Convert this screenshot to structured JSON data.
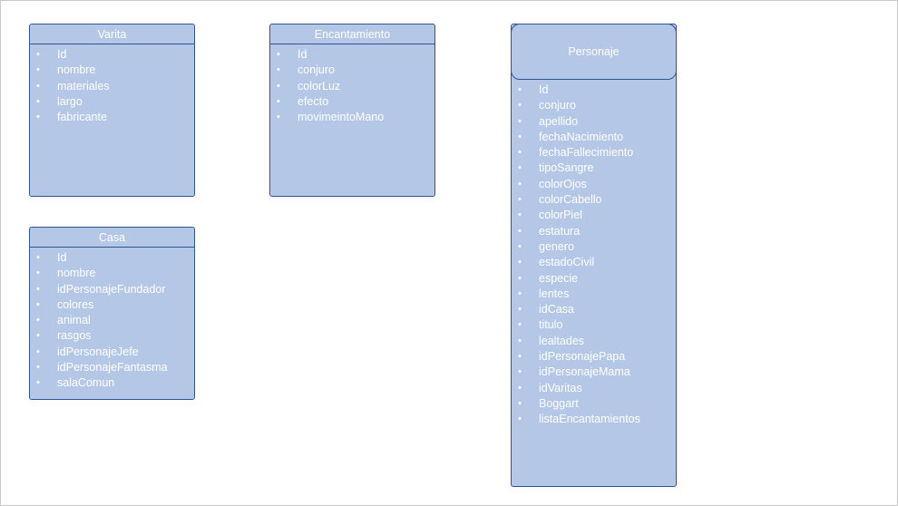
{
  "diagram": {
    "entities": [
      {
        "id": "varita",
        "title": "Varita",
        "fields": [
          "Id",
          "nombre",
          "materiales",
          "largo",
          "fabricante"
        ]
      },
      {
        "id": "encantamiento",
        "title": "Encantamiento",
        "fields": [
          "Id",
          "conjuro",
          "colorLuz",
          "efecto",
          "movimeintoMano"
        ]
      },
      {
        "id": "personaje",
        "title": "Personaje",
        "fields": [
          "Id",
          "conjuro",
          "apellido",
          "fechaNacimiento",
          "fechaFallecimiento",
          "tipoSangre",
          "colorOjos",
          "colorCabello",
          "colorPiel",
          "estatura",
          "genero",
          "estadoCivil",
          "especie",
          "lentes",
          "idCasa",
          "titulo",
          "lealtades",
          "idPersonajePapa",
          "idPersonajeMama",
          "idVaritas",
          "Boggart",
          "listaEncantamientos"
        ]
      },
      {
        "id": "casa",
        "title": "Casa",
        "fields": [
          "Id",
          "nombre",
          "idPersonajeFundador",
          "colores",
          "animal",
          "rasgos",
          "idPersonajeJefe",
          "idPersonajeFantasma",
          "salaComun"
        ]
      }
    ],
    "bullet": "•",
    "colors": {
      "fill": "#b4c7e7",
      "border": "#2f5597",
      "text": "#ffffff"
    }
  }
}
